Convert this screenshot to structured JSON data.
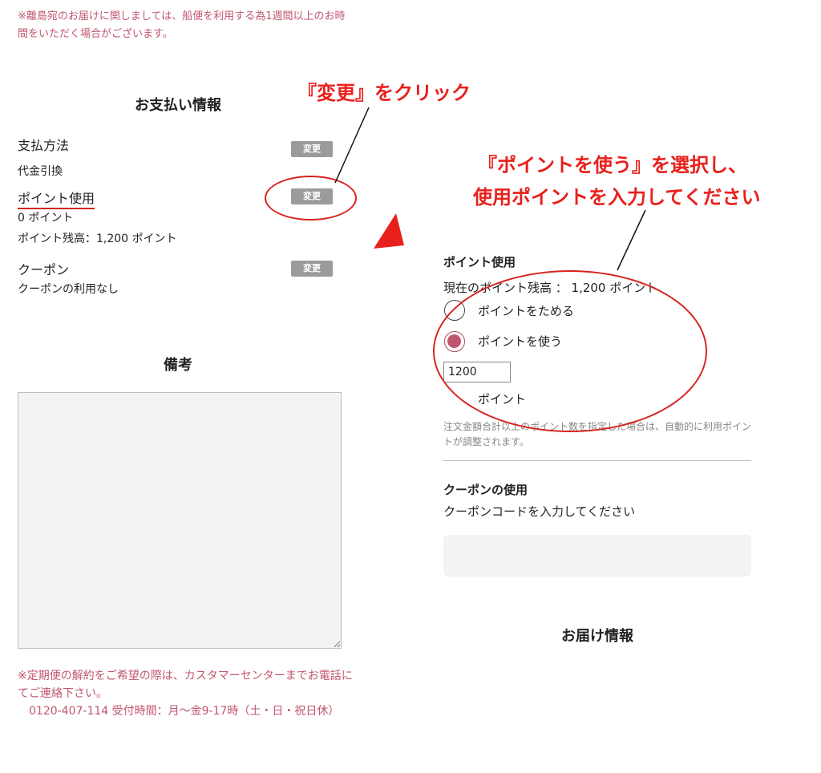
{
  "shipping_note": "※離島宛のお届けに関しましては、船便を利用する為1週間以上のお時間をいただく場合がございます。",
  "payment": {
    "title": "お支払い情報",
    "method_label": "支払方法",
    "method_value": "代金引換",
    "points_label": "ポイント使用",
    "points_value": "0 ポイント",
    "points_balance": "ポイント残高：1,200 ポイント",
    "coupon_label": "クーポン",
    "coupon_value": "クーポンの利用なし",
    "change_label": "変更"
  },
  "remarks": {
    "title": "備考",
    "note": "※定期便の解約をご希望の際は、カスタマーセンターまでお電話にてご連絡下さい。",
    "phone": "0120-407-114 受付時間：月〜金9-17時（土・日・祝日休）"
  },
  "point_panel": {
    "title": "ポイント使用",
    "balance": "現在のポイント残高 ： 1,200 ポイント",
    "option_save": "ポイントをためる",
    "option_use": "ポイントを使う",
    "input_value": "1200",
    "unit": "ポイント",
    "note": "注文金額合計以上のポイント数を指定した場合は、自動的に利用ポイントが調整されます。"
  },
  "coupon_panel": {
    "title": "クーポンの使用",
    "prompt": "クーポンコードを入力してください"
  },
  "delivery": {
    "title": "お届け情報"
  },
  "annotations": {
    "click_change": "『変更』をクリック",
    "select_use_line1": "『ポイントを使う』を選択し、",
    "select_use_line2": "使用ポイントを入力してください"
  },
  "colors": {
    "accent": "#c0566d",
    "annotation_red": "#e8201c",
    "button_gray": "#9b9b9b"
  }
}
